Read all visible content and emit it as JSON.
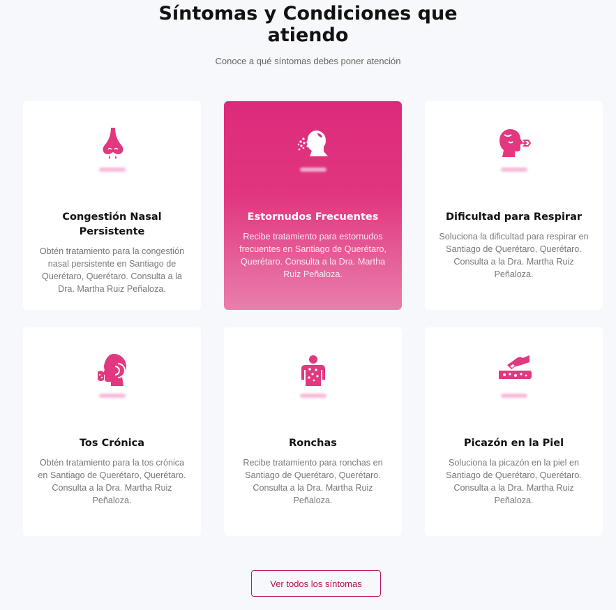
{
  "section": {
    "title_line1": "Síntomas y Condiciones que",
    "title_line2": "atiendo",
    "subtitle": "Conoce a qué síntomas debes poner atención"
  },
  "colors": {
    "accent": "#e2387f",
    "active_card_top": "#dc2a7a",
    "active_card_bottom": "#e97fac",
    "button_border": "#c0185d"
  },
  "cards": [
    {
      "icon": "runny-nose-icon",
      "title": "Congestión Nasal Persistente",
      "description": "Obtén tratamiento para la congestión nasal persistente en Santiago de Querétaro, Querétaro. Consulta a la Dra. Martha Ruiz Peñaloza.",
      "active": false
    },
    {
      "icon": "sneeze-icon",
      "title": "Estornudos Frecuentes",
      "description": "Recibe tratamiento para estornudos frecuentes en Santiago de Querétaro, Querétaro. Consulta a la Dra. Martha Ruiz Peñaloza.",
      "active": true
    },
    {
      "icon": "breathing-difficulty-icon",
      "title": "Dificultad para Respirar",
      "description": "Soluciona la dificultad para respirar en Santiago de Querétaro, Querétaro. Consulta a la Dra. Martha Ruiz Peñaloza.",
      "active": false
    },
    {
      "icon": "cough-icon",
      "title": "Tos Crónica",
      "description": "Obtén tratamiento para la tos crónica en Santiago de Querétaro, Querétaro. Consulta a la Dra. Martha Ruiz Peñaloza.",
      "active": false
    },
    {
      "icon": "hives-icon",
      "title": "Ronchas",
      "description": "Recibe tratamiento para ronchas en Santiago de Querétaro, Querétaro. Consulta a la Dra. Martha Ruiz Peñaloza.",
      "active": false
    },
    {
      "icon": "itchy-skin-icon",
      "title": "Picazón en la Piel",
      "description": "Soluciona la picazón en la piel en Santiago de Querétaro, Querétaro. Consulta a la Dra. Martha Ruiz Peñaloza.",
      "active": false
    }
  ],
  "cta": {
    "label": "Ver todos los síntomas"
  }
}
